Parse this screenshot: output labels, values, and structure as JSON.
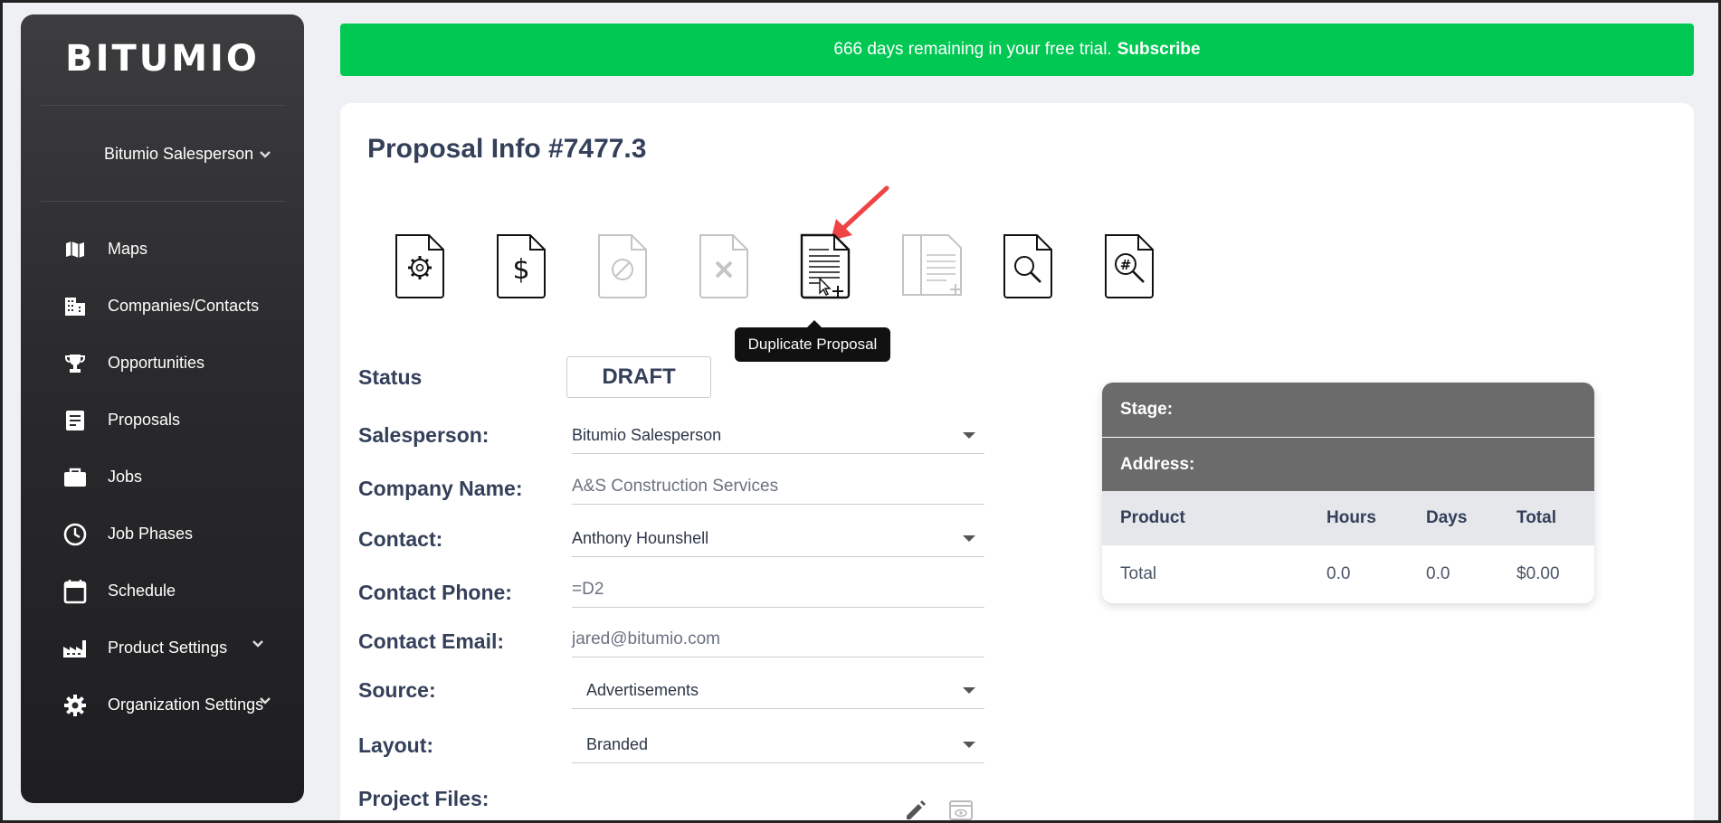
{
  "sidebar": {
    "brand": "BITUMIO",
    "user": "Bitumio Salesperson",
    "items": [
      {
        "label": "Maps",
        "icon": "map-icon"
      },
      {
        "label": "Companies/Contacts",
        "icon": "building-icon"
      },
      {
        "label": "Opportunities",
        "icon": "trophy-icon"
      },
      {
        "label": "Proposals",
        "icon": "document-icon"
      },
      {
        "label": "Jobs",
        "icon": "briefcase-icon"
      },
      {
        "label": "Job Phases",
        "icon": "clock-icon"
      },
      {
        "label": "Schedule",
        "icon": "calendar-icon"
      },
      {
        "label": "Product Settings",
        "icon": "factory-icon"
      },
      {
        "label": "Organization Settings",
        "icon": "gear-icon"
      }
    ]
  },
  "banner": {
    "text": "666 days remaining in your free trial.",
    "link": "Subscribe",
    "color": "#00c853"
  },
  "proposal": {
    "title": "Proposal Info #7477.3",
    "tooltip": "Duplicate Proposal",
    "status_label": "Status",
    "status_value": "DRAFT",
    "fields": {
      "salesperson_label": "Salesperson:",
      "salesperson_value": "Bitumio Salesperson",
      "company_label": "Company Name:",
      "company_value": "A&S Construction Services",
      "contact_label": "Contact:",
      "contact_value": "Anthony Hounshell",
      "phone_label": "Contact Phone:",
      "phone_value": "=D2",
      "email_label": "Contact Email:",
      "email_value": "jared@bitumio.com",
      "source_label": "Source:",
      "source_value": "Advertisements",
      "layout_label": "Layout:",
      "layout_value": "Branded",
      "files_label": "Project Files:"
    }
  },
  "summary": {
    "stage_label": "Stage:",
    "address_label": "Address:",
    "headers": [
      "Product",
      "Hours",
      "Days",
      "Total"
    ],
    "row": [
      "Total",
      "0.0",
      "0.0",
      "$0.00"
    ]
  }
}
